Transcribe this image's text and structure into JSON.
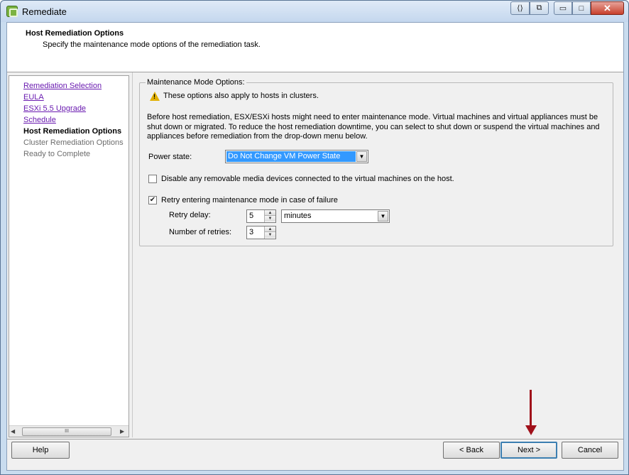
{
  "window": {
    "title": "Remediate",
    "controls": {
      "minimize": "▭",
      "maximize": "□",
      "close": "✕",
      "nav": "⟨⟩",
      "restore": "⧉"
    }
  },
  "header": {
    "title": "Host Remediation Options",
    "subtitle": "Specify the maintenance mode options of the remediation task."
  },
  "nav": {
    "items": [
      {
        "label": "Remediation Selection",
        "state": "link"
      },
      {
        "label": "EULA",
        "state": "link"
      },
      {
        "label": "ESXi 5.5 Upgrade",
        "state": "link"
      },
      {
        "label": "Schedule",
        "state": "link"
      },
      {
        "label": "Host Remediation Options",
        "state": "current"
      },
      {
        "label": "Cluster Remediation Options",
        "state": "disabled"
      },
      {
        "label": "Ready to Complete",
        "state": "disabled"
      }
    ],
    "scroll_left": "◀",
    "scroll_right": "▶",
    "scroll_thumb": "III"
  },
  "maintenance": {
    "legend": "Maintenance Mode Options:",
    "warning": "These options also apply to hosts in clusters.",
    "intro": "Before host remediation, ESX/ESXi hosts might need to enter maintenance mode. Virtual machines and virtual appliances must be shut down or migrated. To reduce the host remediation downtime, you can select to shut down or suspend the virtual machines and appliances before remediation from the drop-down menu below.",
    "power_state_label": "Power state:",
    "power_state_value": "Do Not Change VM Power State",
    "disable_media_label": "Disable any removable media devices connected to the virtual machines on the host.",
    "disable_media_checked": false,
    "retry_label": "Retry entering maintenance mode in case of failure",
    "retry_checked": true,
    "retry_delay_label": "Retry delay:",
    "retry_delay_value": "5",
    "retry_delay_unit": "minutes",
    "retries_label": "Number of retries:",
    "retries_value": "3"
  },
  "footer": {
    "help": "Help",
    "back": "< Back",
    "next": "Next >",
    "cancel": "Cancel"
  },
  "colors": {
    "link": "#6a1bb0",
    "selection": "#3399ff",
    "annotation_arrow": "#a0101a"
  }
}
